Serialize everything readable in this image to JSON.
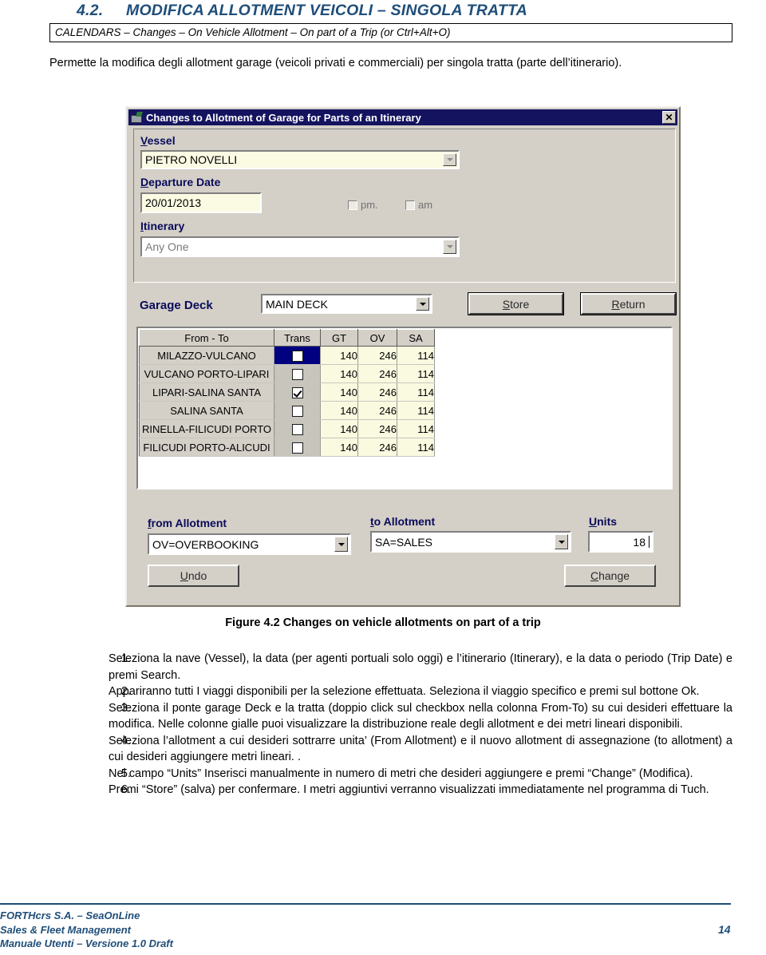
{
  "document": {
    "section_number": "4.2.",
    "section_title": "MODIFICA ALLOTMENT VEICOLI – SINGOLA TRATTA",
    "menu_path": "CALENDARS – Changes – On Vehicle Allotment – On part of a Trip (or Ctrl+Alt+O)",
    "intro": "Permette la modifica degli allotment garage (veicoli privati e commerciali) per singola tratta (parte dell’itinerario).",
    "figure_caption": "Figure 4.2 Changes on vehicle allotments on part of a trip",
    "accent_color": "#1F4E79",
    "steps": [
      {
        "n": "1.",
        "text": "Seleziona la nave (Vessel), la data (per agenti portuali solo oggi) e l’itinerario (Itinerary), e la data o periodo (Trip Date) e premi Search."
      },
      {
        "n": "2.",
        "text": "Appariranno tutti I viaggi disponibili per la selezione effettuata. Seleziona il viaggio specifico e premi sul bottone Ok."
      },
      {
        "n": "3.",
        "text": "Seleziona il ponte garage Deck e la tratta (doppio click sul checkbox nella colonna From-To) su cui desideri effettuare la modifica. Nelle colonne gialle puoi visualizzare la distribuzione reale degli allotment e dei metri lineari disponibili."
      },
      {
        "n": "4.",
        "text": "Seleziona l’allotment a cui desideri sottrarre unita’ (From Allotment) e il nuovo allotment di assegnazione (to allotment) a cui desideri aggiungere metri lineari. ."
      },
      {
        "n": "5.",
        "text": "Nel campo “Units” Inserisci manualmente in numero di metri che desideri aggiungere e premi “Change” (Modifica)."
      },
      {
        "n": "6.",
        "text": "Premi “Store” (salva) per confermare. I metri aggiuntivi verranno visualizzati immediatamente nel programma di Tuch."
      }
    ],
    "footer": {
      "line1": "FORTHcrs S.A. – SeaOnLine",
      "line2": "Sales & Fleet Management",
      "line3": "Manuale Utenti – Versione 1.0 Draft",
      "page_number": "14"
    }
  },
  "dialog": {
    "title": "Changes to Allotment of Garage for Parts of an Itinerary",
    "title_icon": "ship-icon",
    "close_label": "✕",
    "titlebar_color": "#14135F",
    "face_color": "#D4D0C8",
    "vessel": {
      "label": "Vessel",
      "label_accel": "V",
      "value": "PIETRO NOVELLI"
    },
    "departure_date": {
      "label": "Departure Date",
      "label_accel": "D",
      "value": "20/01/2013"
    },
    "pm_checkbox": {
      "label": "pm.",
      "checked": false
    },
    "am_checkbox": {
      "label": "am",
      "checked": false
    },
    "itinerary": {
      "label": "Itinerary",
      "label_accel": "I",
      "value": "Any One"
    },
    "garage_deck": {
      "label": "Garage Deck",
      "value": "MAIN DECK"
    },
    "store_button": "Store",
    "return_button": "Return",
    "grid": {
      "columns": [
        "From - To",
        "Trans",
        "GT",
        "OV",
        "SA"
      ],
      "rows": [
        {
          "route": "MILAZZO-VULCANO",
          "trans": false,
          "selected": true,
          "gt": "140",
          "ov": "246",
          "sa": "114"
        },
        {
          "route": "VULCANO PORTO-LIPARI",
          "trans": false,
          "selected": false,
          "gt": "140",
          "ov": "246",
          "sa": "114"
        },
        {
          "route": "LIPARI-SALINA SANTA",
          "trans": true,
          "selected": false,
          "gt": "140",
          "ov": "246",
          "sa": "114"
        },
        {
          "route": "SALINA SANTA",
          "trans": false,
          "selected": false,
          "gt": "140",
          "ov": "246",
          "sa": "114"
        },
        {
          "route": "RINELLA-FILICUDI PORTO",
          "trans": false,
          "selected": false,
          "gt": "140",
          "ov": "246",
          "sa": "114"
        },
        {
          "route": "FILICUDI PORTO-ALICUDI",
          "trans": false,
          "selected": false,
          "gt": "140",
          "ov": "246",
          "sa": "114"
        }
      ]
    },
    "from_allotment": {
      "label": "from Allotment",
      "value": "OV=OVERBOOKING"
    },
    "to_allotment": {
      "label": "to Allotment",
      "value": "SA=SALES"
    },
    "units": {
      "label": "Units",
      "value": "18"
    },
    "undo_button": "Undo",
    "change_button": "Change"
  }
}
